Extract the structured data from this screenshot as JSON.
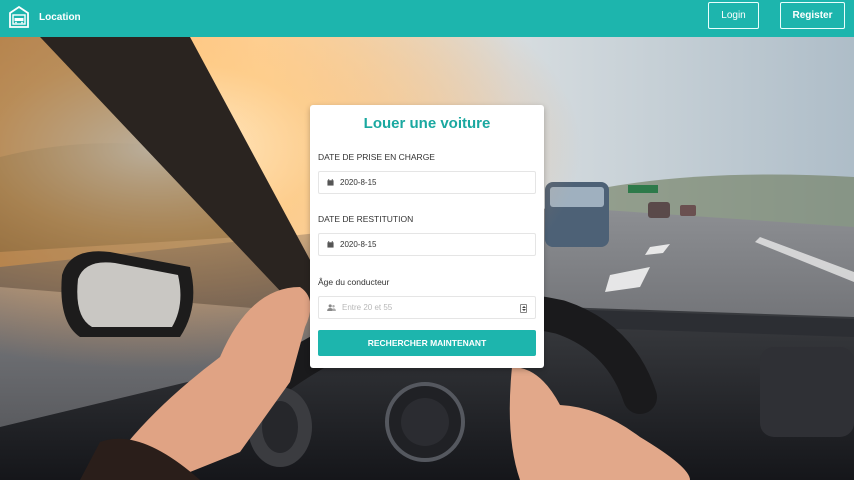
{
  "navbar": {
    "brand_text": "Location",
    "brand_icon": "garage-icon",
    "login_label": "Login",
    "register_label": "Register",
    "background_color": "#1db5ad"
  },
  "form": {
    "title": "Louer une voiture",
    "pickup": {
      "label": "DATE DE PRISE EN CHARGE",
      "value": "2020-8-15",
      "icon": "calendar-icon"
    },
    "return": {
      "label": "DATE DE RESTITUTION",
      "value": "2020-8-15",
      "icon": "calendar-icon"
    },
    "age": {
      "label": "Âge du conducteur",
      "placeholder": "Entre 20 et 55",
      "icon": "users-icon"
    },
    "submit_label": "RECHERCHER MAINTENANT",
    "accent_color": "#1db5ad"
  },
  "background": {
    "description_icon": "car-interior-photo"
  }
}
